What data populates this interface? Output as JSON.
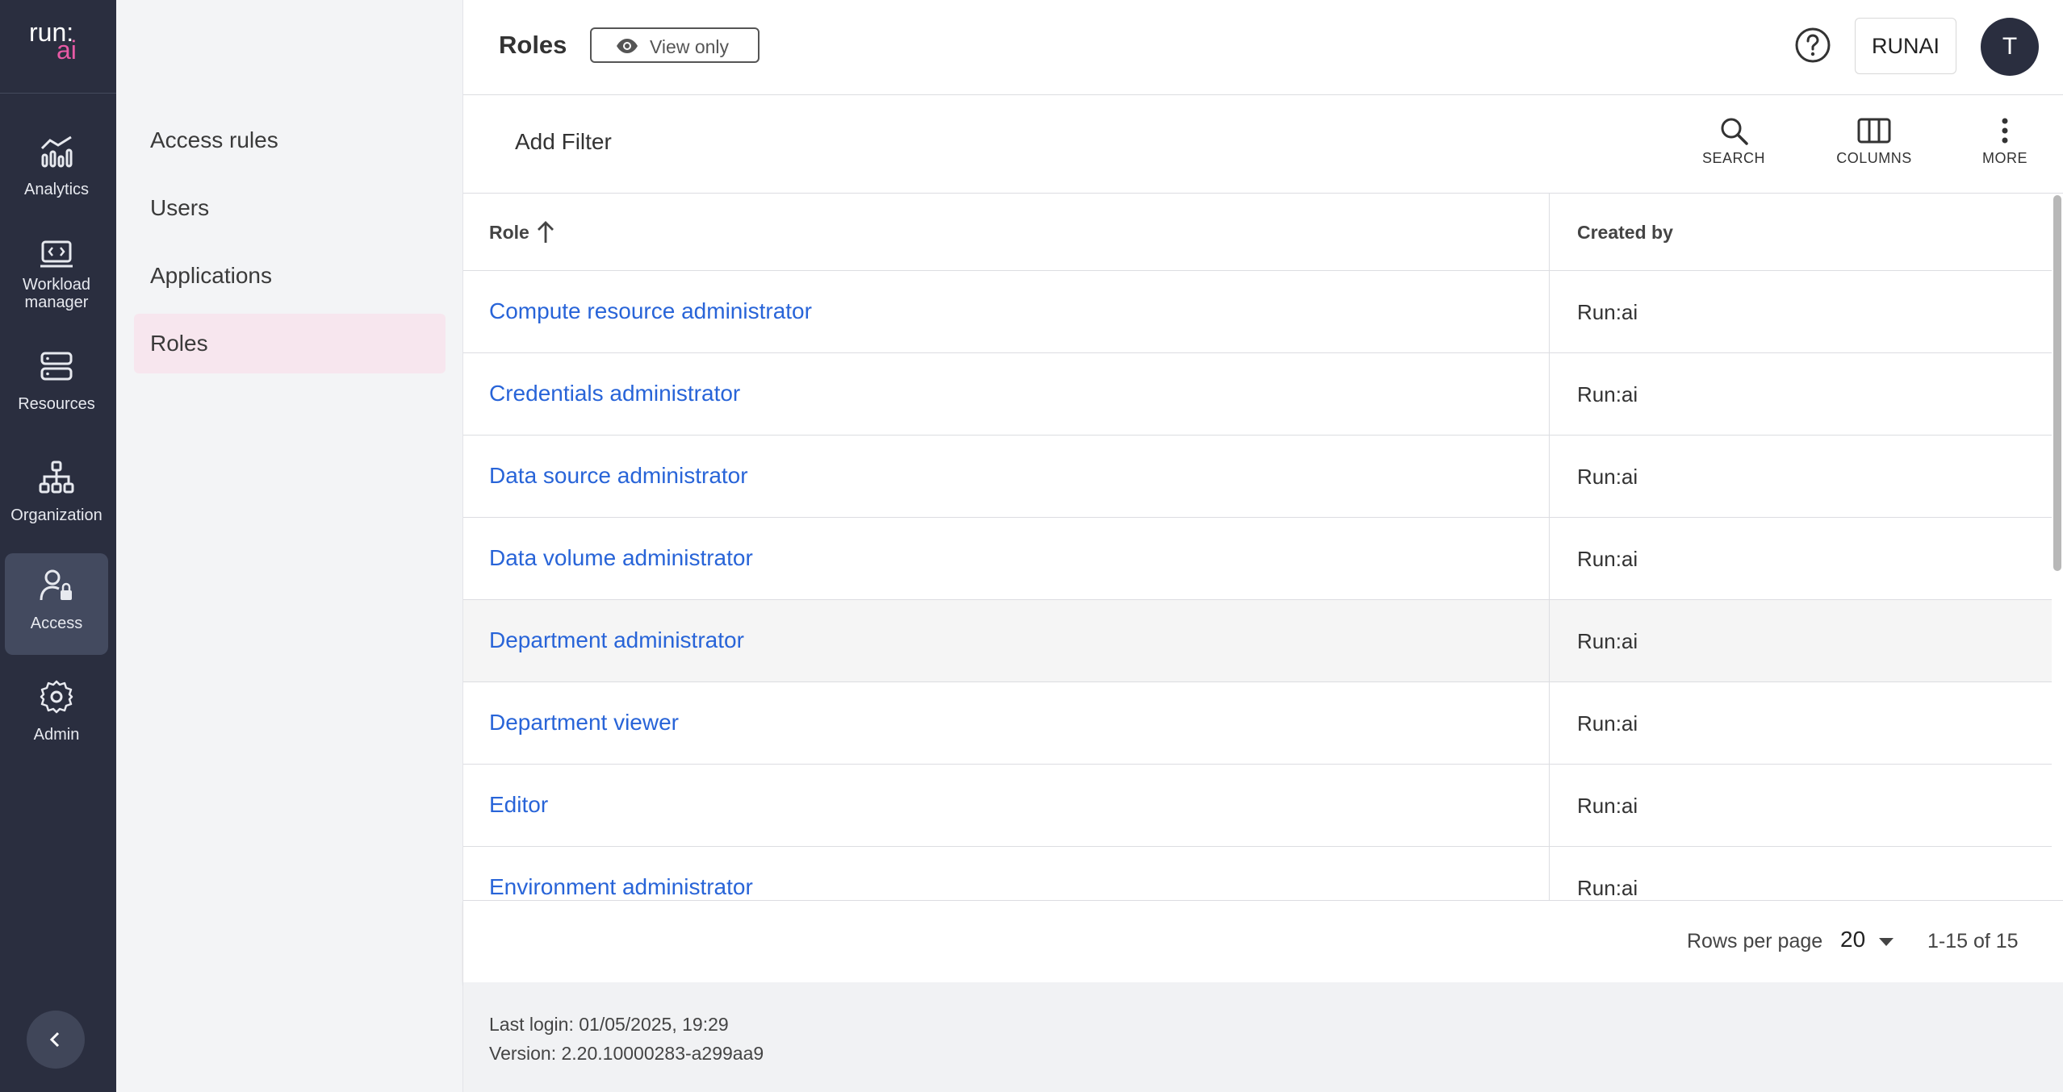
{
  "app": {
    "logo_top": "run:",
    "logo_bottom": "ai"
  },
  "rail": {
    "items": [
      {
        "label": "Analytics",
        "icon": "analytics-icon"
      },
      {
        "label": "Workload manager",
        "icon": "workload-manager-icon"
      },
      {
        "label": "Resources",
        "icon": "resources-icon"
      },
      {
        "label": "Organization",
        "icon": "organization-icon"
      },
      {
        "label": "Access",
        "icon": "access-icon",
        "active": true
      },
      {
        "label": "Admin",
        "icon": "gear-icon"
      }
    ],
    "collapse_icon": "chevron-left-icon"
  },
  "subnav": {
    "items": [
      {
        "label": "Access rules"
      },
      {
        "label": "Users"
      },
      {
        "label": "Applications"
      },
      {
        "label": "Roles",
        "active": true
      }
    ]
  },
  "header": {
    "title": "Roles",
    "view_only_label": "View only",
    "tenant_label": "RUNAI",
    "avatar_initial": "T"
  },
  "toolbar": {
    "add_filter_label": "Add Filter",
    "search_label": "SEARCH",
    "columns_label": "COLUMNS",
    "more_label": "MORE"
  },
  "table": {
    "columns": [
      "Role",
      "Created by"
    ],
    "sort": {
      "column": "Role",
      "direction": "ascending"
    },
    "rows": [
      {
        "role": "Compute resource administrator",
        "created_by": "Run:ai"
      },
      {
        "role": "Credentials administrator",
        "created_by": "Run:ai"
      },
      {
        "role": "Data source administrator",
        "created_by": "Run:ai"
      },
      {
        "role": "Data volume administrator",
        "created_by": "Run:ai"
      },
      {
        "role": "Department administrator",
        "created_by": "Run:ai"
      },
      {
        "role": "Department viewer",
        "created_by": "Run:ai"
      },
      {
        "role": "Editor",
        "created_by": "Run:ai"
      },
      {
        "role": "Environment administrator",
        "created_by": "Run:ai"
      }
    ]
  },
  "pagination": {
    "rows_per_page_label": "Rows per page",
    "rows_per_page_value": "20",
    "range_label": "1-15 of 15"
  },
  "footer": {
    "last_login": "Last login: 01/05/2025, 19:29",
    "version": "Version: 2.20.10000283-a299aa9"
  },
  "colors": {
    "rail_bg": "#2a2e3f",
    "rail_active": "#434a5f",
    "brand_pink": "#e85aa5",
    "link_blue": "#2864d8",
    "subnav_active": "#f7e6ee"
  }
}
